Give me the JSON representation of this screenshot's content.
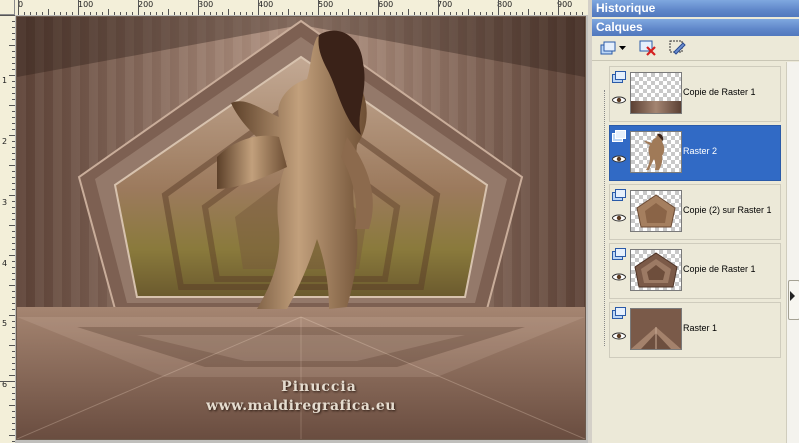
{
  "rulers": {
    "top_labels": [
      "0",
      "100",
      "200",
      "300",
      "400",
      "500",
      "600",
      "700",
      "800",
      "900"
    ],
    "left_labels": [
      "1",
      "2",
      "3",
      "4",
      "5",
      "6"
    ]
  },
  "watermark": {
    "line1": "Pinuccia",
    "line2": "www.maldiregrafica.eu"
  },
  "panels": {
    "history_title": "Historique",
    "layers_title": "Calques"
  },
  "toolbar": {
    "icons": [
      "new-layer-icon",
      "dropdown-arrow-icon",
      "delete-layer-icon",
      "layer-properties-icon"
    ]
  },
  "layers": [
    {
      "name": "Copie de Raster 1",
      "selected": false,
      "thumb": "floor-strip"
    },
    {
      "name": "Raster 2",
      "selected": true,
      "thumb": "figure"
    },
    {
      "name": "Copie (2) sur Raster 1",
      "selected": false,
      "thumb": "pentagon-inner"
    },
    {
      "name": "Copie de Raster 1",
      "selected": false,
      "thumb": "pentagon"
    },
    {
      "name": "Raster 1",
      "selected": false,
      "thumb": "full"
    }
  ],
  "colors": {
    "accent": "#316ac5",
    "panel_title": "#5f86c9",
    "artwork_base": "#8a6a58"
  }
}
